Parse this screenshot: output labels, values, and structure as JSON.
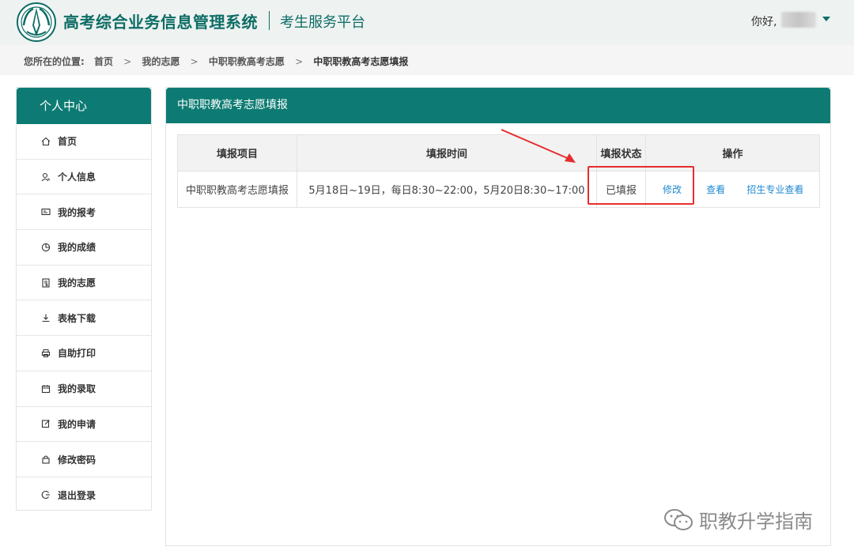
{
  "header": {
    "system_title": "高考综合业务信息管理系统",
    "platform": "考生服务平台",
    "greeting": "你好,"
  },
  "breadcrumb": {
    "prefix": "您所在的位置:",
    "items": [
      "首页",
      "我的志愿",
      "中职职教高考志愿"
    ],
    "current": "中职职教高考志愿填报",
    "separator": ">"
  },
  "sidebar": {
    "title": "个人中心",
    "items": [
      {
        "label": "首页",
        "icon": "home-icon"
      },
      {
        "label": "个人信息",
        "icon": "user-icon"
      },
      {
        "label": "我的报考",
        "icon": "id-card-icon"
      },
      {
        "label": "我的成绩",
        "icon": "pie-chart-icon"
      },
      {
        "label": "我的志愿",
        "icon": "document-icon"
      },
      {
        "label": "表格下载",
        "icon": "download-icon"
      },
      {
        "label": "自助打印",
        "icon": "printer-icon"
      },
      {
        "label": "我的录取",
        "icon": "calendar-icon"
      },
      {
        "label": "我的申请",
        "icon": "edit-icon"
      },
      {
        "label": "修改密码",
        "icon": "lock-icon"
      },
      {
        "label": "退出登录",
        "icon": "logout-icon"
      }
    ]
  },
  "panel": {
    "title": "中职职教高考志愿填报",
    "table": {
      "headers": [
        "填报项目",
        "填报时间",
        "填报状态",
        "操作"
      ],
      "rows": [
        {
          "item": "中职职教高考志愿填报",
          "time": "5月18日~19日，每日8:30~22:00，5月20日8:30~17:00",
          "status": "已填报",
          "actions": [
            "修改",
            "查看",
            "招生专业查看"
          ]
        }
      ]
    }
  },
  "watermark": "职教升学指南",
  "colors": {
    "brand": "#0d7b73",
    "status": "#f0a020",
    "link": "#1e88d2",
    "annotation": "#e62e2e"
  }
}
